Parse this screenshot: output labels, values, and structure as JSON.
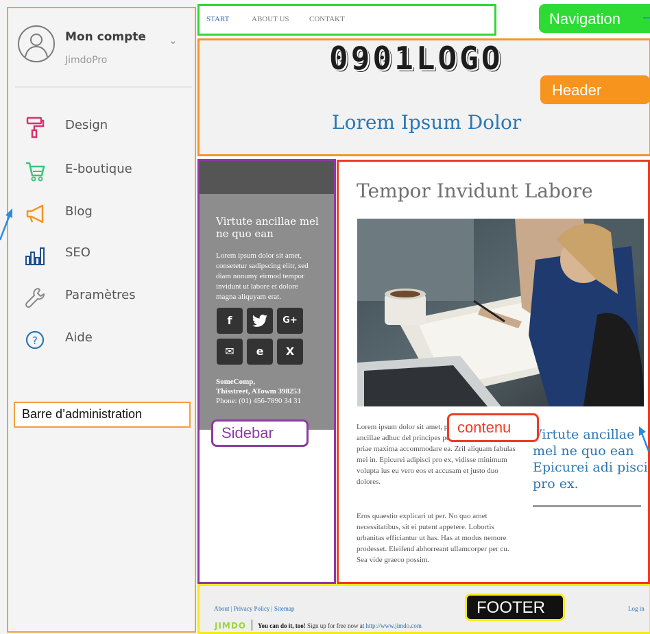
{
  "admin": {
    "account_name": "Mon compte",
    "account_plan": "JimdoPro",
    "items": [
      {
        "label": "Design",
        "icon": "paint-roller-icon",
        "color": "#d6336c"
      },
      {
        "label": "E-boutique",
        "icon": "cart-icon",
        "color": "#3cc47c"
      },
      {
        "label": "Blog",
        "icon": "megaphone-icon",
        "color": "#f7941d"
      },
      {
        "label": "SEO",
        "icon": "bar-chart-icon",
        "color": "#1f4e8c"
      },
      {
        "label": "Paramètres",
        "icon": "wrench-icon",
        "color": "#8a8a8a"
      },
      {
        "label": "Aide",
        "icon": "help-circle-icon",
        "color": "#2b77b3"
      }
    ],
    "annotation": "Barre d’administration"
  },
  "nav": {
    "links": [
      "START",
      "ABOUT US",
      "CONTAKT"
    ],
    "annotation": "Navigation"
  },
  "header": {
    "logo": "0901LOGO",
    "title": "Lorem Ipsum Dolor",
    "annotation": "Header"
  },
  "sidebar": {
    "title": "Virtute ancillae mel ne quo ean",
    "text": "Lorem ipsum dolor sit amet, consetetur sadipscing elitr, sed diam nonumy eirmod tempor invidunt ut labore et dolore magna aliquyam erat.",
    "social": [
      "f",
      "t",
      "G+",
      "✉",
      "e",
      "X"
    ],
    "company": "SomeComp,",
    "street": "Thisstreet, ATowm 398253",
    "phone": "Phone: (01) 456-7890 34 31",
    "annotation": "Sidebar"
  },
  "content": {
    "heading": "Tempor Invidunt Labore",
    "para1": "Lorem ipsum dolor sit amet, possim sed et. Virtute ancillae adhuc del principes persequeris, ius am pro priae maxima accommodare ea. Zril aliquam fabulas mei in. Epicurei adipisci pro ex, vidisse minimum volupta ius eu vero eos et accusam et justo duo dolores.",
    "para2": "Eros quaestio explicari ut per. No quo amet necessitatibus, sit ei putent appetere. Lobortis urbanitas efficiantur ut has. Has at modus nemore prodesset. Eleifend abhorreant ullamcorper per cu. Sea vide graeco possim.",
    "quote": "Virtute ancillae mel ne quo ean Epicurei adi pisci pro ex.",
    "annotation": "contenu"
  },
  "footer": {
    "links": "About | Privacy Policy | Sitemap",
    "login": "Log in",
    "jimdo": "JIMDO",
    "promo_bold": "You can do it, too!",
    "promo_text": " Sign up for free now at ",
    "promo_url": "http://www.jimdo.com",
    "annotation": "FOOTER"
  },
  "colors": {
    "nav_frame": "#33d633",
    "header_frame": "#f2962c",
    "sidebar_frame": "#8e3aa3",
    "content_frame": "#ef3b24",
    "footer_frame": "#f7e91c",
    "accent_blue": "#2b77b3"
  }
}
